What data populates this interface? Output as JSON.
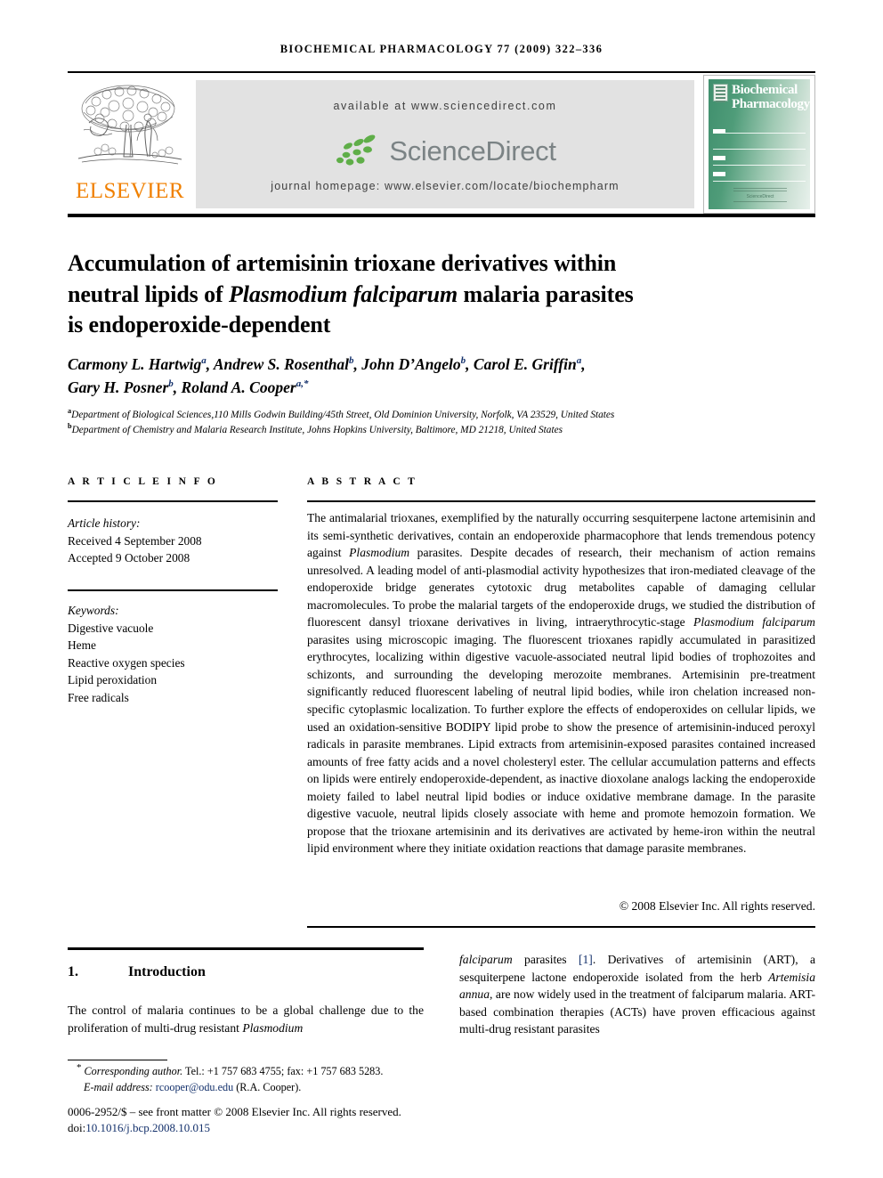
{
  "journal": {
    "running_head": "BIOCHEMICAL PHARMACOLOGY 77 (2009) 322–336",
    "publisher_name": "ELSEVIER",
    "available_at": "available at www.sciencedirect.com",
    "sciencedirect_name": "ScienceDirect",
    "homepage": "journal homepage: www.elsevier.com/locate/biochempharm",
    "cover_title_line1": "Biochemical",
    "cover_title_line2": "Pharmacology",
    "cover_footer": "ScienceDirect"
  },
  "article": {
    "title_line1": "Accumulation of artemisinin trioxane derivatives within",
    "title_line2_a": "neutral lipids of ",
    "title_line2_italic": "Plasmodium falciparum",
    "title_line2_b": " malaria parasites",
    "title_line3": "is endoperoxide-dependent",
    "authors": [
      {
        "name": "Carmony L. Hartwig",
        "sup": "a",
        "sep": ", "
      },
      {
        "name": "Andrew S. Rosenthal",
        "sup": "b",
        "sep": ", "
      },
      {
        "name": "John D’Angelo",
        "sup": "b",
        "sep": ", "
      },
      {
        "name": "Carol E. Griffin",
        "sup": "a",
        "sep": ","
      },
      {
        "name": "Gary H. Posner",
        "sup": "b",
        "sep": ", "
      },
      {
        "name": "Roland A. Cooper",
        "sup": "a,*",
        "sep": ""
      }
    ],
    "affiliations": [
      {
        "mark": "a",
        "text": "Department of Biological Sciences,110 Mills Godwin Building/45th Street, Old Dominion University, Norfolk, VA 23529, United States"
      },
      {
        "mark": "b",
        "text": "Department of Chemistry and Malaria Research Institute, Johns Hopkins University, Baltimore, MD 21218, United States"
      }
    ]
  },
  "article_info": {
    "heading": "A R T I C L E  I N F O",
    "history_label": "Article history:",
    "received": "Received 4 September 2008",
    "accepted": "Accepted 9 October 2008",
    "keywords_label": "Keywords:",
    "keywords": [
      "Digestive vacuole",
      "Heme",
      "Reactive oxygen species",
      "Lipid peroxidation",
      "Free radicals"
    ]
  },
  "abstract": {
    "heading": "A B S T R A C T",
    "part1": "The antimalarial trioxanes, exemplified by the naturally occurring sesquiterpene lactone artemisinin and its semi-synthetic derivatives, contain an endoperoxide pharmacophore that lends tremendous potency against ",
    "italic1": "Plasmodium",
    "part2": " parasites. Despite decades of research, their mechanism of action remains unresolved. A leading model of anti-plasmodial activity hypothesizes that iron-mediated cleavage of the endoperoxide bridge generates cytotoxic drug metabolites capable of damaging cellular macromolecules. To probe the malarial targets of the endoperoxide drugs, we studied the distribution of fluorescent dansyl trioxane derivatives in living, intraerythrocytic-stage ",
    "italic2": "Plasmodium falciparum",
    "part3": " parasites using microscopic imaging. The fluorescent trioxanes rapidly accumulated in parasitized erythrocytes, localizing within digestive vacuole-associated neutral lipid bodies of trophozoites and schizonts, and surrounding the developing merozoite membranes. Artemisinin pre-treatment significantly reduced fluorescent labeling of neutral lipid bodies, while iron chelation increased non-specific cytoplasmic localization. To further explore the effects of endoperoxides on cellular lipids, we used an oxidation-sensitive BODIPY lipid probe to show the presence of artemisinin-induced peroxyl radicals in parasite membranes. Lipid extracts from artemisinin-exposed parasites contained increased amounts of free fatty acids and a novel cholesteryl ester. The cellular accumulation patterns and effects on lipids were entirely endoperoxide-dependent, as inactive dioxolane analogs lacking the endoperoxide moiety failed to label neutral lipid bodies or induce oxidative membrane damage. In the parasite digestive vacuole, neutral lipids closely associate with heme and promote hemozoin formation. We propose that the trioxane artemisinin and its derivatives are activated by heme-iron within the neutral lipid environment where they initiate oxidation reactions that damage parasite membranes.",
    "copyright": "© 2008 Elsevier Inc. All rights reserved."
  },
  "body": {
    "section_number": "1.",
    "section_title": "Introduction",
    "left_part1": "The control of malaria continues to be a global challenge due to the proliferation of multi-drug resistant ",
    "left_italic1": "Plasmodium",
    "right_italic1": "falciparum",
    "right_part1": " parasites ",
    "right_ref": "[1]",
    "right_part2": ". Derivatives of artemisinin (ART), a sesquiterpene lactone endoperoxide isolated from the herb ",
    "right_italic2": "Artemisia annua",
    "right_part3": ", are now widely used in the treatment of falciparum malaria. ART-based combination therapies (ACTs) have proven efficacious against multi-drug resistant parasites"
  },
  "footnote": {
    "star": "*",
    "corresponding_label": "Corresponding author.",
    "contact": " Tel.: +1 757 683 4755; fax: +1 757 683 5283.",
    "email_label": "E-mail address:",
    "email": "rcooper@odu.edu",
    "email_owner": "(R.A. Cooper).",
    "frontmatter": "0006-2952/$ – see front matter © 2008 Elsevier Inc. All rights reserved.",
    "doi_label": "doi:",
    "doi": "10.1016/j.bcp.2008.10.015"
  },
  "colors": {
    "elsevier_orange": "#F08000",
    "sciencedirect_green": "#5FAE48",
    "sciencedirect_gray": "#7b8385",
    "link_blue": "#13306b",
    "band_gray": "#e2e2e2"
  }
}
